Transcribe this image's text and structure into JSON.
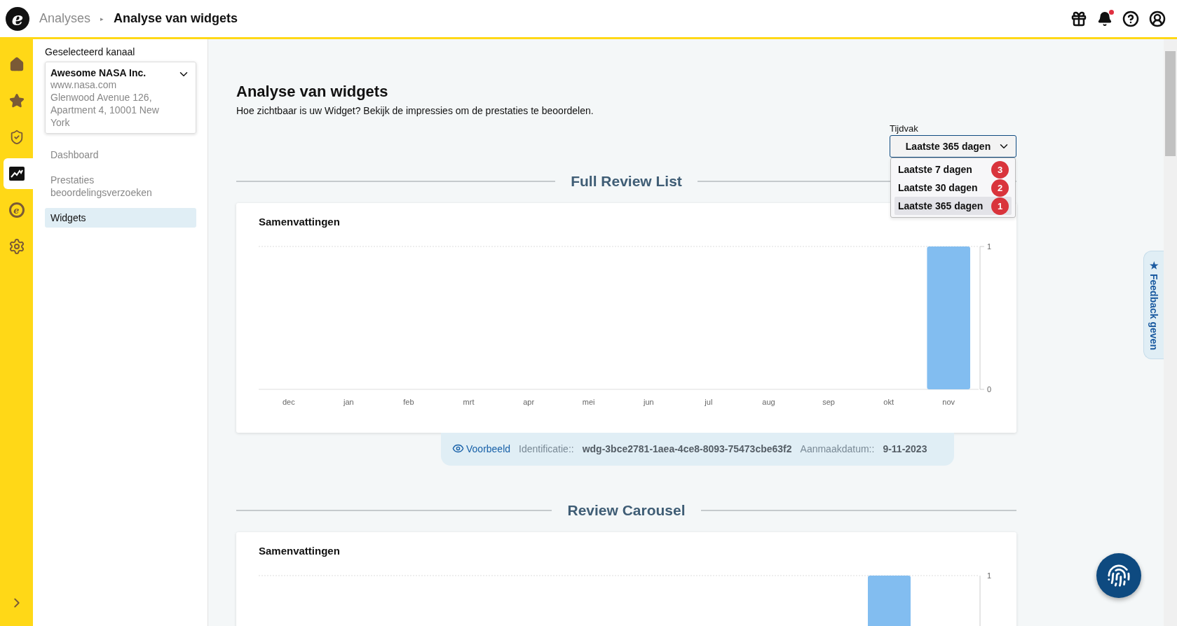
{
  "header": {
    "logo_letter": "e",
    "breadcrumb": "Analyses",
    "separator": "▸",
    "title": "Analyse van widgets",
    "notifications_unread": true
  },
  "rail": {
    "items": [
      {
        "kind": "home",
        "selected": false
      },
      {
        "kind": "star",
        "selected": false
      },
      {
        "kind": "shield",
        "selected": false
      },
      {
        "kind": "chart",
        "selected": true
      },
      {
        "kind": "logo",
        "letter": "e",
        "selected": false
      },
      {
        "kind": "settings",
        "selected": false
      }
    ]
  },
  "sidebar": {
    "label": "Geselecteerd kanaal",
    "channel": {
      "name": "Awesome NASA Inc.",
      "website": "www.nasa.com",
      "address": "Glenwood Avenue 126, Apartment 4, 10001 New York"
    },
    "items": [
      {
        "label": "Dashboard",
        "selected": false
      },
      {
        "label": "Prestaties beoordelingsverzoeken",
        "selected": false
      },
      {
        "label": "Widgets",
        "selected": true
      }
    ]
  },
  "page": {
    "title": "Analyse van widgets",
    "subtitle": "Hoe zichtbaar is uw Widget? Bekijk de impressies om de prestaties te beoordelen."
  },
  "period": {
    "label": "Tijdvak",
    "value": "Laatste 365 dagen",
    "expanded": true,
    "options": [
      {
        "label": "Laatste 7 dagen",
        "badge": "3",
        "selected": false
      },
      {
        "label": "Laatste 30 dagen",
        "badge": "2",
        "selected": false
      },
      {
        "label": "Laatste 365 dagen",
        "badge": "1",
        "selected": true
      }
    ]
  },
  "widgets": [
    {
      "section": "Full Review List",
      "card_title": "Samenvattingen",
      "chart_data": {
        "type": "bar",
        "categories": [
          "dec",
          "jan",
          "feb",
          "mrt",
          "apr",
          "mei",
          "jun",
          "jul",
          "aug",
          "sep",
          "okt",
          "nov"
        ],
        "values": [
          0,
          0,
          0,
          0,
          0,
          0,
          0,
          0,
          0,
          0,
          0,
          1
        ],
        "ylim": [
          0,
          1
        ],
        "yticks": [
          0,
          1
        ]
      },
      "footer": {
        "preview": "Voorbeeld",
        "id_label": "Identificatie::",
        "id": "wdg-3bce2781-1aea-4ce8-8093-75473cbe63f2",
        "date_label": "Aanmaakdatum::",
        "date": "9-11-2023"
      }
    },
    {
      "section": "Review Carousel",
      "card_title": "Samenvattingen",
      "top_tick": "1"
    }
  ],
  "feedback_tab": {
    "icon": "★",
    "label": "Feedback geven"
  }
}
